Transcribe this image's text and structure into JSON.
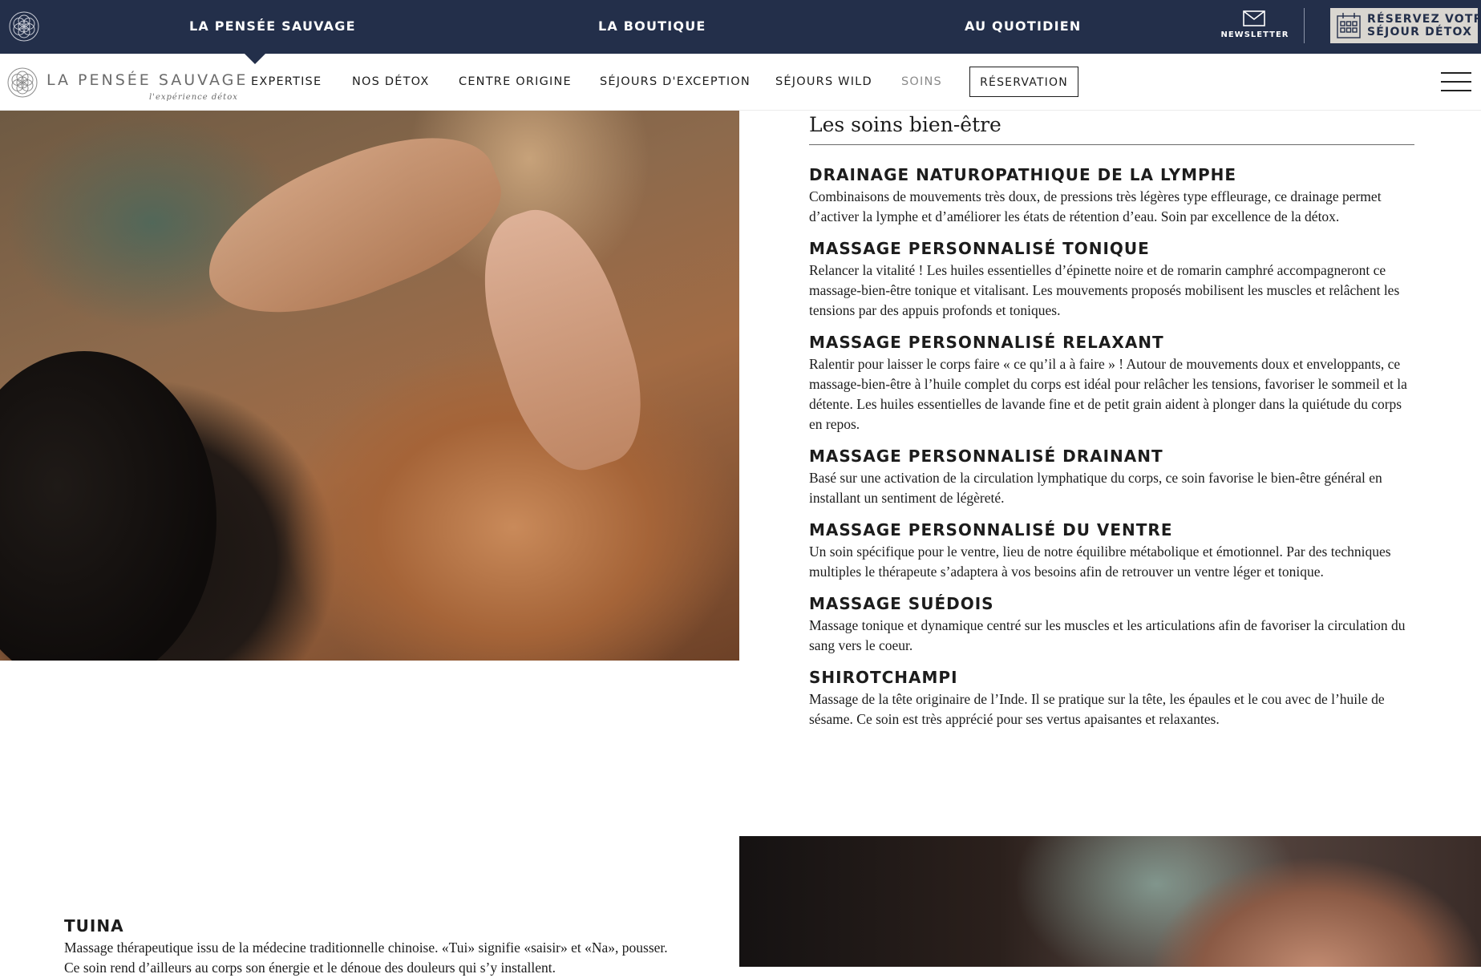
{
  "topbar": {
    "links": [
      "LA PENSÉE SAUVAGE",
      "LA BOUTIQUE",
      "AU QUOTIDIEN"
    ],
    "newsletter_label": "NEWSLETTER",
    "book_line1": "RÉSERVEZ VOTRE",
    "book_line2": "SÉJOUR DÉTOX",
    "colors": {
      "bar": "#232f4a",
      "book_bg": "#d9d6d0"
    }
  },
  "brand": {
    "name": "LA PENSÉE SAUVAGE",
    "tagline": "l'expérience détox"
  },
  "nav": {
    "items": [
      "EXPERTISE",
      "NOS DÉTOX",
      "CENTRE ORIGINE",
      "SÉJOURS D'EXCEPTION",
      "SÉJOURS WILD",
      "SOINS"
    ],
    "reserve_label": "RÉSERVATION"
  },
  "main": {
    "section_title": "Les soins bien-être",
    "soins": [
      {
        "title": "DRAINAGE NATUROPATHIQUE DE LA LYMPHE",
        "text": "Combinaisons de mouvements très doux, de pressions très légères type effleurage, ce drainage permet d’activer la lymphe et d’améliorer les états de rétention d’eau. Soin par excellence de la détox."
      },
      {
        "title": "MASSAGE PERSONNALISÉ TONIQUE",
        "text": "Relancer la vitalité ! Les huiles essentielles d’épinette noire et de romarin camphré accompagneront ce massage-bien-être tonique et vitalisant. Les mouvements proposés mobilisent les muscles et relâchent les tensions par des appuis profonds et toniques."
      },
      {
        "title": "MASSAGE PERSONNALISÉ RELAXANT",
        "text": "Ralentir pour laisser le corps faire « ce qu’il a à faire » ! Autour de mouvements doux et enveloppants, ce massage-bien-être à l’huile complet du corps est idéal pour relâcher les tensions, favoriser le sommeil et la détente. Les huiles essentielles de lavande fine et de petit grain aident à plonger dans la quiétude du corps en repos."
      },
      {
        "title": "MASSAGE PERSONNALISÉ DRAINANT",
        "text": "Basé sur une activation de la circulation lymphatique du corps, ce soin favorise le bien-être général en installant un sentiment de légèreté."
      },
      {
        "title": "MASSAGE PERSONNALISÉ DU VENTRE",
        "text": "Un soin spécifique pour le ventre, lieu de notre équilibre métabolique et émotionnel. Par des techniques multiples le thérapeute s’adaptera à vos besoins afin de retrouver un ventre léger et tonique."
      },
      {
        "title": "MASSAGE SUÉDOIS",
        "text": "Massage tonique et dynamique centré sur les muscles et les articulations afin de favoriser la circulation du sang vers le coeur."
      },
      {
        "title": "SHIROTCHAMPI",
        "text": "Massage de la tête originaire de l’Inde. Il se pratique sur la tête, les épaules et le cou avec de l’huile de sésame. Ce soin est très apprécié pour ses vertus apaisantes et relaxantes."
      }
    ],
    "tuina": {
      "title": "TUINA",
      "text": "Massage thérapeutique issu de la médecine traditionnelle chinoise. «Tui» signifie «saisir» et «Na», pousser. Ce soin rend d’ailleurs au corps son énergie et le dénoue des douleurs qui s’y installent."
    }
  }
}
